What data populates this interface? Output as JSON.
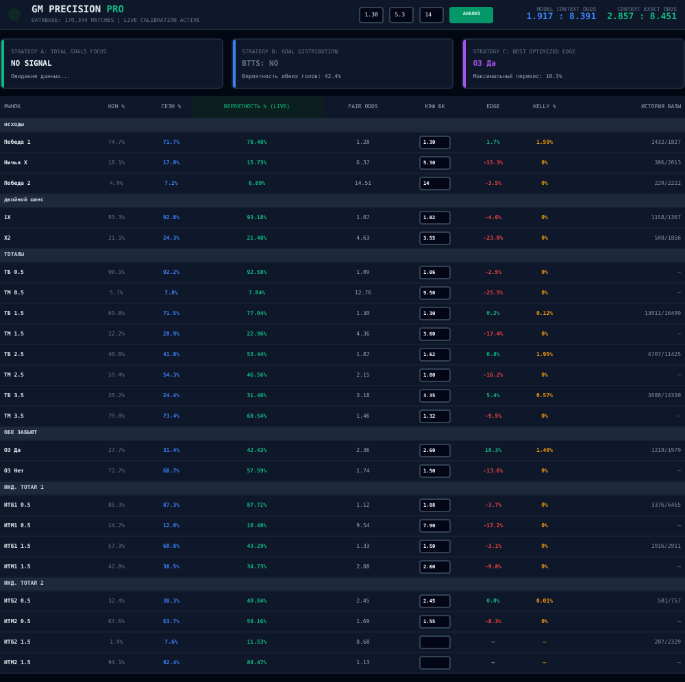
{
  "header": {
    "title": "GM PRECISION",
    "title_badge": "PRO",
    "subtitle": "DATABASE: 170,344 MATCHES | LIVE CALIBRATION ACTIVE",
    "inputs": [
      "1.30",
      "5.3",
      "14"
    ],
    "button": "АНАЛИЗ",
    "odds": [
      {
        "label": "MODEL CONTEXT ODDS",
        "value": "1.917 : 8.391",
        "color": "#3b82f6"
      },
      {
        "label": "CONTEXT EXACT ODDS",
        "value": "2.857 : 8.451",
        "color": "#10b981"
      }
    ]
  },
  "strategies": [
    {
      "label": "STRATEGY A: TOTAL GOALS FOCUS",
      "value": "NO SIGNAL",
      "note": "Ожидание данных...",
      "color": "#10b981",
      "kind": "idle"
    },
    {
      "label": "STRATEGY B: GOAL DISTRIBUTION",
      "value": "BTTS: NO",
      "note": "Вероятность обеих голов: 42.4%",
      "color": "#3b82f6",
      "kind": "muted"
    },
    {
      "label": "STRATEGY C: BEST OPTIMIZED EDGE",
      "value": "ОЗ Да",
      "note": "Максимальный перевес: 10.3%",
      "color": "#a855f7",
      "kind": "signal"
    }
  ],
  "table": {
    "columns": [
      "РЫНОК",
      "H2H %",
      "СЕЗН %",
      "ВЕРОЯТНОСТЬ % (LIVE)",
      "FAIR ODDS",
      "КЭФ БК",
      "EDGE",
      "KELLY %",
      "ИСТОРИЯ БАЗЫ"
    ],
    "groups": [
      {
        "title": "исходы",
        "rows": [
          {
            "name": "Победа 1",
            "h2h": "74.7%",
            "season": "71.7%",
            "prob": "78.48%",
            "fair": "1.28",
            "odds": "1.30",
            "edge": "1.7%",
            "kind": "gain",
            "kelly": "1.59%",
            "history": "1432/1827"
          },
          {
            "name": "Ничья X",
            "h2h": "18.1%",
            "season": "17.0%",
            "prob": "15.73%",
            "fair": "6.37",
            "odds": "5.30",
            "edge": "-15.3%",
            "kind": "loss",
            "kelly": "0%",
            "history": "306/2013"
          },
          {
            "name": "Победа 2",
            "h2h": "4.9%",
            "season": "7.2%",
            "prob": "6.89%",
            "fair": "14.51",
            "odds": "14",
            "edge": "-3.5%",
            "kind": "loss",
            "kelly": "0%",
            "history": "229/2222"
          }
        ]
      },
      {
        "title": "двойной шанс",
        "rows": [
          {
            "name": "1X",
            "h2h": "93.3%",
            "season": "92.8%",
            "prob": "93.18%",
            "fair": "1.07",
            "odds": "1.02",
            "edge": "-4.6%",
            "kind": "loss",
            "kelly": "0%",
            "history": "1158/1367"
          },
          {
            "name": "X2",
            "h2h": "21.1%",
            "season": "24.3%",
            "prob": "21.48%",
            "fair": "4.63",
            "odds": "3.55",
            "edge": "-23.0%",
            "kind": "loss",
            "kelly": "0%",
            "history": "508/1856"
          }
        ]
      },
      {
        "title": "ТОТАЛЫ",
        "rows": [
          {
            "name": "ТБ 0.5",
            "h2h": "90.1%",
            "season": "92.2%",
            "prob": "92.58%",
            "fair": "1.09",
            "odds": "1.06",
            "edge": "-2.5%",
            "kind": "loss",
            "kelly": "0%",
            "history": "—"
          },
          {
            "name": "ТМ 0.5",
            "h2h": "5.7%",
            "season": "7.8%",
            "prob": "7.84%",
            "fair": "12.76",
            "odds": "9.50",
            "edge": "-25.5%",
            "kind": "loss",
            "kelly": "0%",
            "history": "—"
          },
          {
            "name": "ТБ 1.5",
            "h2h": "69.8%",
            "season": "71.5%",
            "prob": "77.04%",
            "fair": "1.30",
            "odds": "1.30",
            "edge": "0.2%",
            "kind": "gain",
            "kelly": "0.12%",
            "history": "13011/16499"
          },
          {
            "name": "ТМ 1.5",
            "h2h": "22.2%",
            "season": "28.9%",
            "prob": "22.96%",
            "fair": "4.36",
            "odds": "3.60",
            "edge": "-17.4%",
            "kind": "loss",
            "kelly": "0%",
            "history": "—"
          },
          {
            "name": "ТБ 2.5",
            "h2h": "40.8%",
            "season": "41.8%",
            "prob": "53.44%",
            "fair": "1.87",
            "odds": "1.62",
            "edge": "0.8%",
            "kind": "gain",
            "kelly": "1.95%",
            "history": "4707/11425"
          },
          {
            "name": "ТМ 2.5",
            "h2h": "59.4%",
            "season": "54.3%",
            "prob": "46.56%",
            "fair": "2.15",
            "odds": "1.80",
            "edge": "-16.2%",
            "kind": "loss",
            "kelly": "0%",
            "history": "—"
          },
          {
            "name": "ТБ 3.5",
            "h2h": "20.2%",
            "season": "24.4%",
            "prob": "31.46%",
            "fair": "3.18",
            "odds": "3.35",
            "edge": "5.4%",
            "kind": "gain",
            "kelly": "0.57%",
            "history": "3088/14330"
          },
          {
            "name": "ТМ 3.5",
            "h2h": "79.8%",
            "season": "73.4%",
            "prob": "68.54%",
            "fair": "1.46",
            "odds": "1.32",
            "edge": "-9.5%",
            "kind": "loss",
            "kelly": "0%",
            "history": "—"
          }
        ]
      },
      {
        "title": "ОБЕ ЗАБЬЮТ",
        "rows": [
          {
            "name": "ОЗ Да",
            "h2h": "27.7%",
            "season": "31.4%",
            "prob": "42.43%",
            "fair": "2.36",
            "odds": "2.60",
            "edge": "10.3%",
            "kind": "gain",
            "kelly": "1.40%",
            "history": "1219/1979"
          },
          {
            "name": "ОЗ Нет",
            "h2h": "72.7%",
            "season": "68.7%",
            "prob": "57.59%",
            "fair": "1.74",
            "odds": "1.50",
            "edge": "-13.6%",
            "kind": "loss",
            "kelly": "0%",
            "history": "—"
          }
        ]
      },
      {
        "title": "ИНД. ТОТАЛ 1",
        "rows": [
          {
            "name": "ИТБ1 0.5",
            "h2h": "85.3%",
            "season": "87.3%",
            "prob": "87.72%",
            "fair": "1.12",
            "odds": "1.08",
            "edge": "-3.7%",
            "kind": "loss",
            "kelly": "0%",
            "history": "3376/6455"
          },
          {
            "name": "ИТМ1 0.5",
            "h2h": "14.7%",
            "season": "12.8%",
            "prob": "10.48%",
            "fair": "9.54",
            "odds": "7.90",
            "edge": "-17.2%",
            "kind": "loss",
            "kelly": "0%",
            "history": "—"
          },
          {
            "name": "ИТБ1 1.5",
            "h2h": "57.3%",
            "season": "60.8%",
            "prob": "43.29%",
            "fair": "1.33",
            "odds": "1.50",
            "edge": "-3.1%",
            "kind": "loss",
            "kelly": "0%",
            "history": "1916/2911"
          },
          {
            "name": "ИТМ1 1.5",
            "h2h": "42.8%",
            "season": "38.5%",
            "prob": "34.73%",
            "fair": "2.88",
            "odds": "2.60",
            "edge": "-9.8%",
            "kind": "loss",
            "kelly": "0%",
            "history": "—"
          }
        ]
      },
      {
        "title": "ИНД. ТОТАЛ 2",
        "rows": [
          {
            "name": "ИТБ2 0.5",
            "h2h": "32.4%",
            "season": "38.3%",
            "prob": "40.84%",
            "fair": "2.45",
            "odds": "2.45",
            "edge": "0.0%",
            "kind": "gain",
            "kelly": "0.01%",
            "history": "501/757"
          },
          {
            "name": "ИТМ2 0.5",
            "h2h": "67.6%",
            "season": "63.7%",
            "prob": "59.16%",
            "fair": "1.69",
            "odds": "1.55",
            "edge": "-8.3%",
            "kind": "loss",
            "kelly": "0%",
            "history": "—"
          },
          {
            "name": "ИТБ2 1.5",
            "h2h": "1.9%",
            "season": "7.6%",
            "prob": "11.53%",
            "fair": "8.68",
            "edge": "—",
            "kind": "empty",
            "kelly": "—",
            "history": "207/2329"
          },
          {
            "name": "ИТМ2 1.5",
            "h2h": "94.1%",
            "season": "92.4%",
            "prob": "88.47%",
            "fair": "1.13",
            "edge": "—",
            "kind": "empty",
            "kelly": "—",
            "history": "—"
          }
        ]
      }
    ]
  }
}
